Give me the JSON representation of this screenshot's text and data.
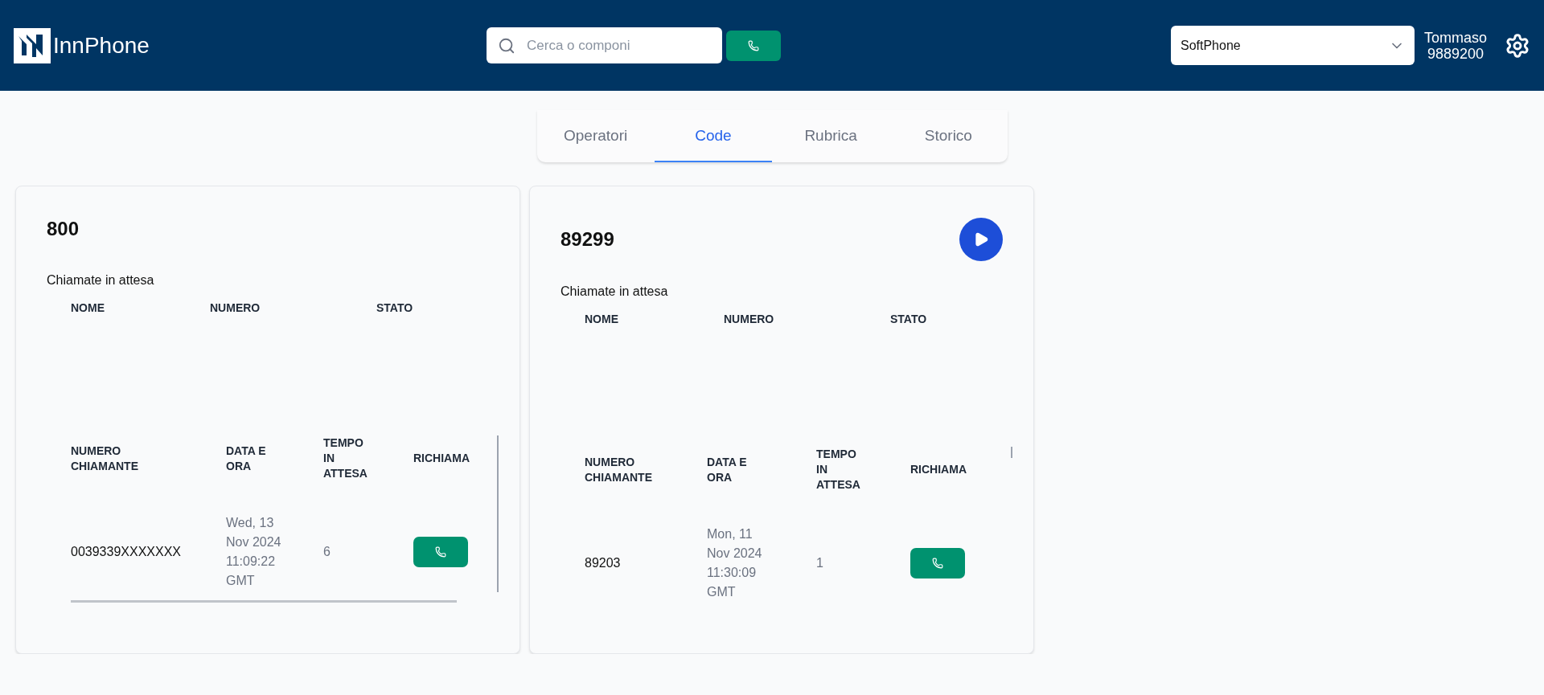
{
  "header": {
    "logo": "InnPhone",
    "search": {
      "placeholder": "Cerca o componi"
    },
    "device_select": {
      "value": "SoftPhone"
    },
    "user": {
      "name": "Tommaso",
      "extension": "9889200"
    }
  },
  "tabs": [
    {
      "label": "Operatori",
      "selected": false
    },
    {
      "label": "Code",
      "selected": true
    },
    {
      "label": "Rubrica",
      "selected": false
    },
    {
      "label": "Storico",
      "selected": false
    }
  ],
  "queues": [
    {
      "name": "800",
      "play_button": false,
      "waiting_label": "Chiamate in attesa",
      "agents_columns": [
        "NOME",
        "NUMERO",
        "STATO"
      ],
      "calls_columns": [
        "NUMERO CHIAMANTE",
        "DATA E ORA",
        "TEMPO IN ATTESA",
        "RICHIAMA"
      ],
      "calls": [
        {
          "caller": "0039339XXXXXXX",
          "date": "Wed, 13 Nov 2024 11:09:22 GMT",
          "wait": "6"
        }
      ]
    },
    {
      "name": "89299",
      "play_button": true,
      "waiting_label": "Chiamate in attesa",
      "agents_columns": [
        "NOME",
        "NUMERO",
        "STATO"
      ],
      "calls_columns": [
        "NUMERO CHIAMANTE",
        "DATA E ORA",
        "TEMPO IN ATTESA",
        "RICHIAMA"
      ],
      "calls": [
        {
          "caller": "89203",
          "date": "Mon, 11 Nov 2024 11:30:09 GMT",
          "wait": "1"
        }
      ]
    }
  ]
}
